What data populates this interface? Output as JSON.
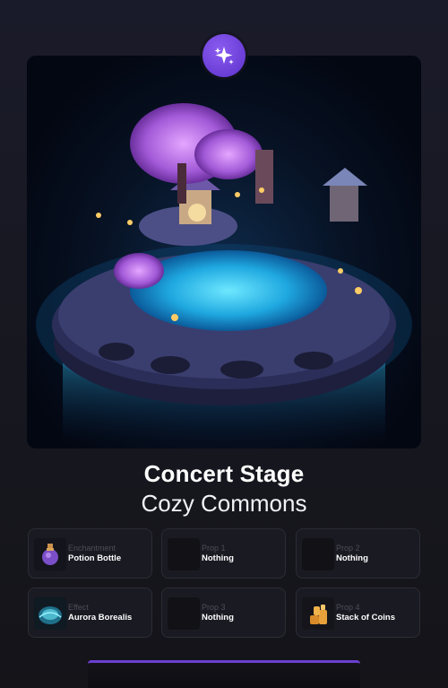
{
  "header": {
    "badge_icon": "sparkles-icon",
    "badge_color": "#6a3dd6"
  },
  "item": {
    "title": "Concert Stage",
    "collection": "Cozy Commons"
  },
  "slots": [
    {
      "kind": "Enchantment",
      "value": "Potion Bottle",
      "icon": "potion-bottle-icon"
    },
    {
      "kind": "Prop 1",
      "value": "Nothing",
      "icon": "empty-slot"
    },
    {
      "kind": "Prop 2",
      "value": "Nothing",
      "icon": "empty-slot"
    },
    {
      "kind": "Effect",
      "value": "Aurora Borealis",
      "icon": "aurora-borealis-icon"
    },
    {
      "kind": "Prop 3",
      "value": "Nothing",
      "icon": "empty-slot"
    },
    {
      "kind": "Prop 4",
      "value": "Stack of Coins",
      "icon": "stack-of-coins-icon"
    }
  ],
  "colors": {
    "accent": "#6b3fd1",
    "glow": "#2fd3ff"
  }
}
